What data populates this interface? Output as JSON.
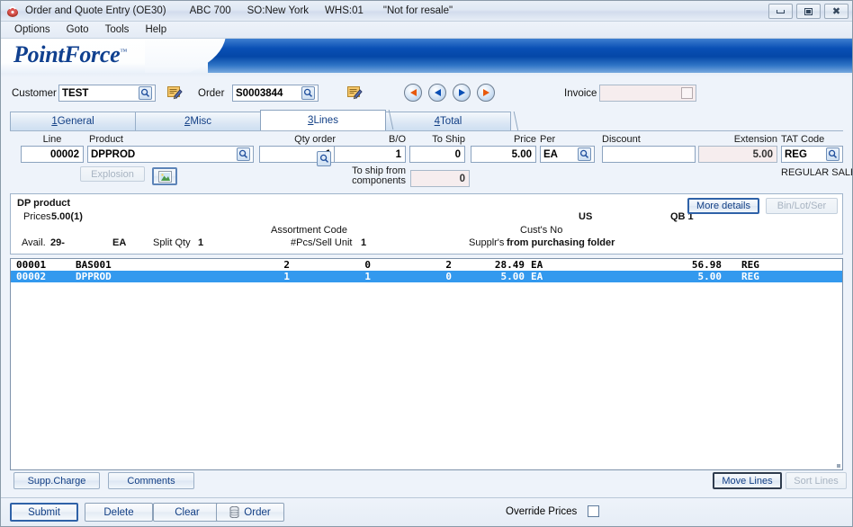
{
  "window": {
    "title": "Order and Quote Entry (OE30)",
    "company": "ABC 700",
    "so_location": "SO:New York",
    "warehouse": "WHS:01",
    "notice": "\"Not for resale\"",
    "icon": "app-icon",
    "controls": {
      "minimize": "minimize",
      "maximize": "maximize",
      "close": "close"
    }
  },
  "menu": {
    "items": [
      "Options",
      "Goto",
      "Tools",
      "Help"
    ]
  },
  "brand": {
    "name_regular": "Point",
    "name_bold": "Force",
    "tm": "™"
  },
  "header": {
    "customer_label": "Customer",
    "customer_value": "TEST",
    "order_label": "Order",
    "order_value": "S0003844",
    "invoice_label": "Invoice",
    "invoice_value": ""
  },
  "nav": {
    "first": "first-record",
    "previous": "previous-record",
    "next": "next-record",
    "last": "last-record"
  },
  "tabs": [
    {
      "num": "1",
      "label": " General",
      "active": false
    },
    {
      "num": "2",
      "label": " Misc",
      "active": false
    },
    {
      "num": "3",
      "label": " Lines",
      "active": true
    },
    {
      "num": "4",
      "label": " Total",
      "active": false
    }
  ],
  "line_detail": {
    "line_label": "Line",
    "line_value": "00002",
    "product_label": "Product",
    "product_value": "DPPROD",
    "qty_order_label": "Qty order",
    "qty_order_value": "1",
    "bo_label": "B/O",
    "bo_value": "1",
    "to_ship_label": "To Ship",
    "to_ship_value": "0",
    "price_label": "Price",
    "price_value": "5.00",
    "per_label": "Per",
    "per_value": "EA",
    "discount_label": "Discount",
    "discount_value": "",
    "extension_label": "Extension",
    "extension_value": "5.00",
    "tat_code_label": "TAT Code",
    "tat_code_value": "REG",
    "tat_description": "REGULAR SALE",
    "explosion_button": "Explosion",
    "explosion_accel": "E",
    "to_ship_from_components_label_1": "To ship from",
    "to_ship_from_components_label_2": "components",
    "to_ship_from_components_value": "0"
  },
  "info_panel": {
    "title": "DP product",
    "prices_label": "Prices",
    "prices_value": "5.00(1)",
    "avail_label": "Avail.",
    "avail_value": "29-",
    "uom": "EA",
    "split_qty_label": "Split Qty",
    "split_qty_value": "1",
    "assortment_code_label": "Assortment Code",
    "pcs_per_sell_unit_label": "#Pcs/Sell Unit",
    "pcs_per_sell_unit_value": "1",
    "country": "US",
    "qb_label": "QB 1",
    "custs_no_label": "Cust's No",
    "custs_no_value": "",
    "supplrs_label": "Supplr's",
    "supplrs_value": "from purchasing folder",
    "more_details_button": "More details",
    "more_details_accel": "M",
    "bin_lot_ser_button": "Bin/Lot/Ser"
  },
  "grid": {
    "rows": [
      {
        "line": "00001",
        "product": "BAS001",
        "qty_order": "2",
        "bo": "0",
        "to_ship": "2",
        "price": "28.49",
        "per": "EA",
        "extension": "56.98",
        "tat": "REG",
        "selected": false
      },
      {
        "line": "00002",
        "product": "DPPROD",
        "qty_order": "1",
        "bo": "1",
        "to_ship": "0",
        "price": "5.00",
        "per": "EA",
        "extension": "5.00",
        "tat": "REG",
        "selected": true
      }
    ]
  },
  "toolbar_lower": {
    "supp_charge": "Supp.Charge",
    "supp_charge_accel": "S",
    "comments": "Comments",
    "comments_accel": "C",
    "move_lines": "Move Lines",
    "move_lines_accel": "v",
    "sort_lines": "Sort Lines"
  },
  "footer": {
    "submit": "Submit",
    "submit_accel": "u",
    "delete": "Delete",
    "delete_accel": "D",
    "clear": "Clear",
    "order": "Order",
    "order_accel": "O",
    "override_prices_label": "Override Prices",
    "override_prices_checked": false
  },
  "colors": {
    "banner_blue": "#0a50b5",
    "selection": "#3399ee",
    "button_text": "#123f85",
    "readonly_bg": "#f6edee"
  }
}
